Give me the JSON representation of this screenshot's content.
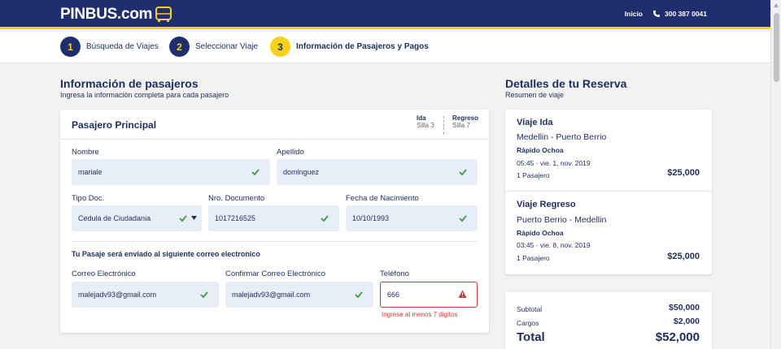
{
  "header": {
    "logo": "PINBUS.com",
    "inicio": "Inicio",
    "phone": "300 387 0041"
  },
  "steps": [
    {
      "num": "1",
      "label": "Búsqueda de Viajes"
    },
    {
      "num": "2",
      "label": "Seleccionar Viaje"
    },
    {
      "num": "3",
      "label": "Información de Pasajeros y Pagos"
    }
  ],
  "passengers": {
    "title": "Información de pasajeros",
    "subtitle": "Ingresa la información completa para cada pasajero",
    "card": {
      "title": "Pasajero Principal",
      "seat_ida_label": "Ida",
      "seat_ida_value": "Silla 3",
      "seat_regreso_label": "Regreso",
      "seat_regreso_value": "Silla 7"
    },
    "fields": {
      "nombre_label": "Nombre",
      "nombre_value": "mariale",
      "apellido_label": "Apellido",
      "apellido_value": "dominguez",
      "tipo_doc_label": "Tipo Doc.",
      "tipo_doc_value": "Cedula de Ciudadania",
      "nro_doc_label": "Nro. Documento",
      "nro_doc_value": "1017216525",
      "fecha_label": "Fecha de Nacimiento",
      "fecha_value": "10/10/1993",
      "email_note": "Tu Pasaje será enviado al siguiente correo electronico",
      "correo_label": "Correo Electrónico",
      "correo_value": "malejadv93@gmail.com",
      "confirm_label": "Confirmar Correo Electrónico",
      "confirm_value": "malejadv93@gmail.com",
      "telefono_label": "Teléfono",
      "telefono_value": "666",
      "telefono_error": "Ingrese al menos 7 digitos"
    }
  },
  "reserva": {
    "title": "Detalles de tu Reserva",
    "subtitle": "Resumen de viaje",
    "ida": {
      "title": "Viaje Ida",
      "route": "Medellin - Puerto Berrio",
      "company": "Rápido Ochoa",
      "time": "05:45 · vie. 1, nov. 2019",
      "passengers": "1 Pasajero",
      "price": "$25,000"
    },
    "regreso": {
      "title": "Viaje Regreso",
      "route": "Puerto Berrio - Medellin",
      "company": "Rápido Ochoa",
      "time": "03:45 · vie. 8, nov. 2019",
      "passengers": "1 Pasajero",
      "price": "$25,000"
    },
    "totals": {
      "subtotal_label": "Subtotal",
      "subtotal_value": "$50,000",
      "cargos_label": "Cargos",
      "cargos_value": "$2,000",
      "total_label": "Total",
      "total_value": "$52,000"
    }
  },
  "colors": {
    "navy": "#1f2e6e",
    "yellow": "#f2d21b",
    "error": "#c23b3b",
    "check": "#3f9b3a"
  }
}
